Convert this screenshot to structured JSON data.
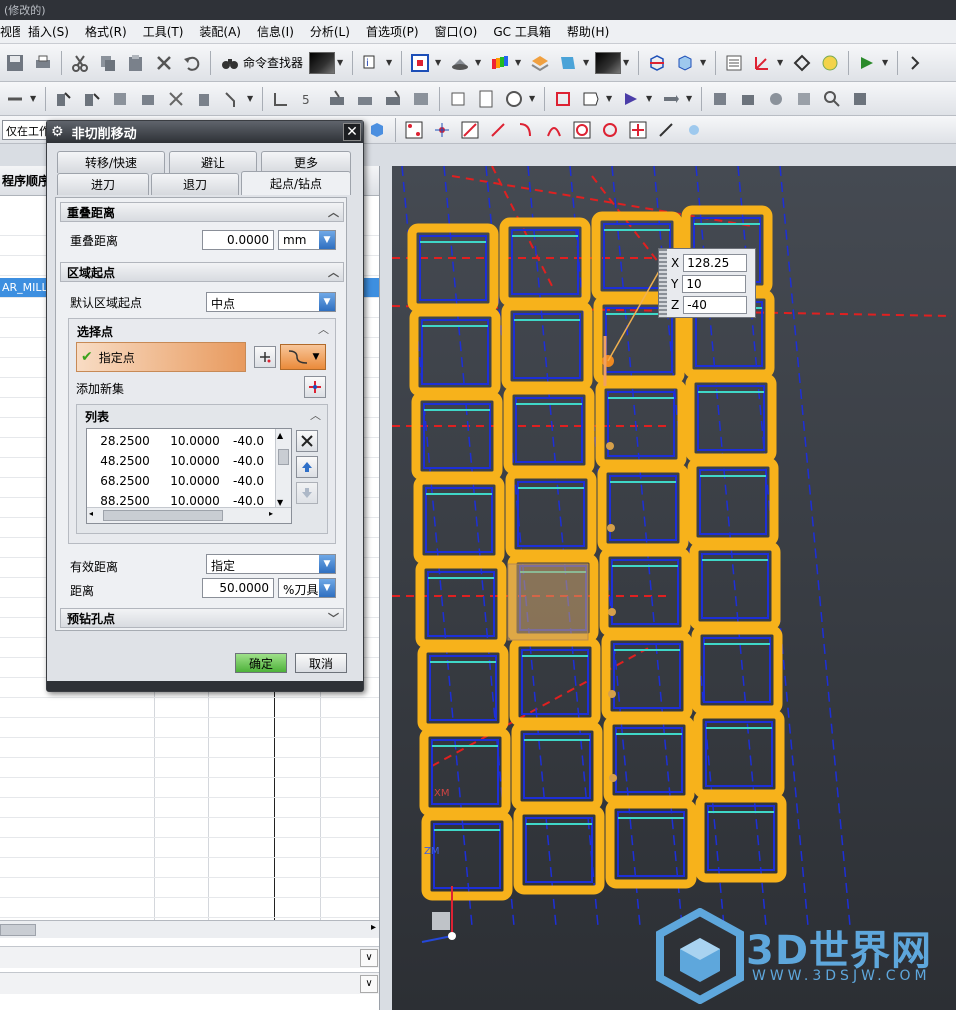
{
  "window": {
    "title_fragment": "(修改的)"
  },
  "menu": [
    "视图(V)",
    "插入(S)",
    "格式(R)",
    "工具(T)",
    "装配(A)",
    "信息(I)",
    "分析(L)",
    "首选项(P)",
    "窗口(O)",
    "GC 工具箱",
    "帮助(H)"
  ],
  "toolbar": {
    "command_finder": "命令查找器",
    "filter_value": "仅在工作"
  },
  "navigator": {
    "header": "程序顺序",
    "selected_row": "AR_MILL"
  },
  "dialog": {
    "title": "非切削移动",
    "tabs_row1": [
      "转移/快速",
      "避让",
      "更多"
    ],
    "tabs_row2": [
      "进刀",
      "退刀",
      "起点/钻点"
    ],
    "active_tab": "起点/钻点",
    "overlap": {
      "header": "重叠距离",
      "label": "重叠距离",
      "value": "0.0000",
      "unit": "mm"
    },
    "region_start": {
      "header": "区域起点",
      "default_label": "默认区域起点",
      "default_value": "中点"
    },
    "select_points": {
      "header": "选择点",
      "specify_point": "指定点",
      "add_new_set": "添加新集"
    },
    "list": {
      "header": "列表",
      "rows": [
        [
          "28.2500",
          "10.0000",
          "-40.0"
        ],
        [
          "48.2500",
          "10.0000",
          "-40.0"
        ],
        [
          "68.2500",
          "10.0000",
          "-40.0"
        ],
        [
          "88.2500",
          "10.0000",
          "-40.0"
        ]
      ]
    },
    "effective_distance": {
      "label": "有效距离",
      "value": "指定"
    },
    "distance": {
      "label": "距离",
      "value": "50.0000",
      "unit": "%刀具"
    },
    "predrill": {
      "header": "预钻孔点"
    },
    "ok": "确定",
    "cancel": "取消"
  },
  "coord_input": {
    "x_label": "X",
    "x": "128.25",
    "y_label": "Y",
    "y": "10",
    "z_label": "Z",
    "z": "-40"
  },
  "viewport": {
    "axis_xm": "XM",
    "axis_zm": "ZM"
  },
  "watermark": {
    "brand": "3D世界网",
    "url": "WWW.3DSJW.COM"
  },
  "colors": {
    "pocket_orange": "#f7b21b",
    "toolpath_blue": "#1d2fd8",
    "rapid_red": "#e02020",
    "ok_green": "#4eb23a"
  }
}
